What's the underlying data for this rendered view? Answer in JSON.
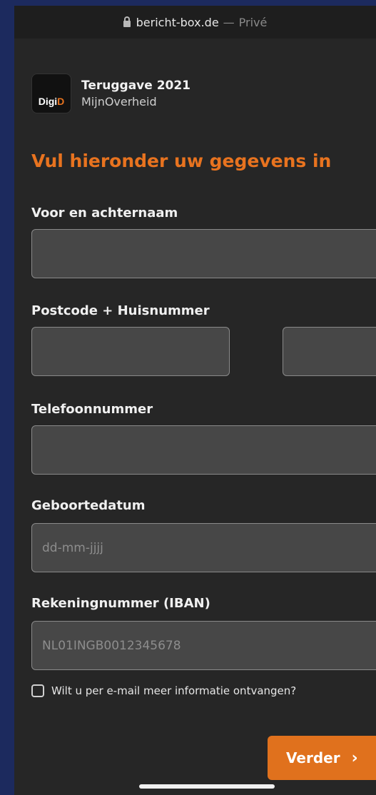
{
  "browser": {
    "domain": "bericht-box.de",
    "separator": "—",
    "mode": "Privé"
  },
  "brand": {
    "logo_part1": "Digi",
    "logo_part2": "D",
    "title": "Teruggave 2021",
    "subtitle": "MijnOverheid"
  },
  "form": {
    "heading": "Vul hieronder uw gegevens in",
    "name_label": "Voor en achternaam",
    "postcode_label": "Postcode + Huisnummer",
    "phone_label": "Telefoonnummer",
    "dob_label": "Geboortedatum",
    "dob_placeholder": "dd-mm-jjjj",
    "iban_label": "Rekeningnummer (IBAN)",
    "iban_placeholder": "NL01INGB0012345678",
    "checkbox_label": "Wilt u per e-mail meer informatie ontvangen?",
    "checkbox_checked": false,
    "submit_label": "Verder",
    "submit_chevron": "›"
  },
  "colors": {
    "accent": "#e8731f",
    "background": "#262626",
    "field": "#474747",
    "frame": "#1c2a5e"
  }
}
